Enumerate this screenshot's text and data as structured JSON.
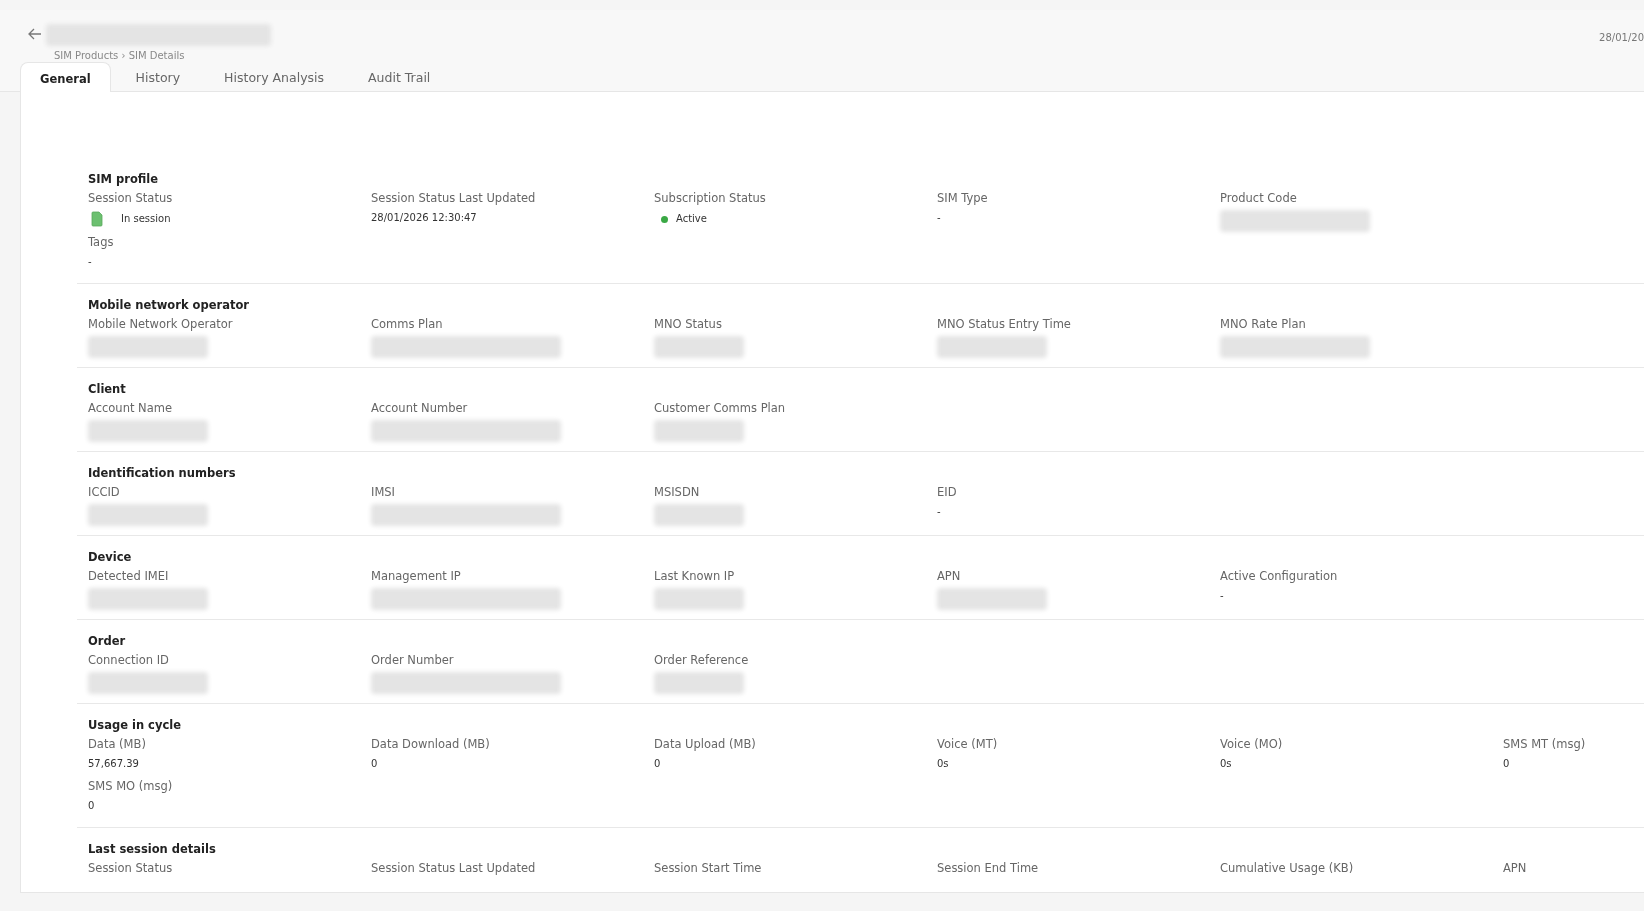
{
  "header": {
    "title_redacted": true,
    "breadcrumb": "SIM Products › SIM Details",
    "date": "28/01/20"
  },
  "tabs": [
    {
      "label": "General",
      "selected": true
    },
    {
      "label": "History",
      "selected": false
    },
    {
      "label": "History Analysis",
      "selected": false
    },
    {
      "label": "Audit Trail",
      "selected": false
    }
  ],
  "sections": [
    {
      "title": "SIM profile",
      "rows": [
        [
          {
            "label": "Session Status",
            "kind": "sim-status",
            "value": "In session"
          },
          {
            "label": "Session Status Last Updated",
            "kind": "text",
            "value": "28/01/2026 12:30:47"
          },
          {
            "label": "Subscription Status",
            "kind": "dot",
            "value": "Active",
            "color": "#3aa845"
          },
          {
            "label": "SIM Type",
            "kind": "text",
            "value": "-"
          },
          {
            "label": "Product Code",
            "kind": "redacted"
          }
        ],
        [
          {
            "label": "Tags",
            "kind": "text",
            "value": "-"
          }
        ]
      ]
    },
    {
      "title": "Mobile network operator",
      "rows": [
        [
          {
            "label": "Mobile Network Operator",
            "kind": "redacted"
          },
          {
            "label": "Comms Plan",
            "kind": "redacted"
          },
          {
            "label": "MNO Status",
            "kind": "redacted"
          },
          {
            "label": "MNO Status Entry Time",
            "kind": "redacted"
          },
          {
            "label": "MNO Rate Plan",
            "kind": "redacted"
          }
        ]
      ]
    },
    {
      "title": "Client",
      "rows": [
        [
          {
            "label": "Account Name",
            "kind": "redacted"
          },
          {
            "label": "Account Number",
            "kind": "redacted"
          },
          {
            "label": "Customer Comms Plan",
            "kind": "redacted"
          }
        ]
      ]
    },
    {
      "title": "Identification numbers",
      "rows": [
        [
          {
            "label": "ICCID",
            "kind": "redacted"
          },
          {
            "label": "IMSI",
            "kind": "redacted"
          },
          {
            "label": "MSISDN",
            "kind": "redacted"
          },
          {
            "label": "EID",
            "kind": "text",
            "value": "-"
          }
        ]
      ]
    },
    {
      "title": "Device",
      "rows": [
        [
          {
            "label": "Detected IMEI",
            "kind": "redacted"
          },
          {
            "label": "Management IP",
            "kind": "redacted"
          },
          {
            "label": "Last Known IP",
            "kind": "redacted"
          },
          {
            "label": "APN",
            "kind": "redacted"
          },
          {
            "label": "Active Configuration",
            "kind": "text",
            "value": "-"
          }
        ]
      ]
    },
    {
      "title": "Order",
      "rows": [
        [
          {
            "label": "Connection ID",
            "kind": "redacted"
          },
          {
            "label": "Order Number",
            "kind": "redacted"
          },
          {
            "label": "Order Reference",
            "kind": "redacted"
          }
        ]
      ]
    },
    {
      "title": "Usage in cycle",
      "rows": [
        [
          {
            "label": "Data (MB)",
            "kind": "text",
            "value": "57,667.39"
          },
          {
            "label": "Data Download (MB)",
            "kind": "text",
            "value": "0"
          },
          {
            "label": "Data Upload (MB)",
            "kind": "text",
            "value": "0"
          },
          {
            "label": "Voice (MT)",
            "kind": "text",
            "value": "0s"
          },
          {
            "label": "Voice (MO)",
            "kind": "text",
            "value": "0s"
          },
          {
            "label": "SMS MT (msg)",
            "kind": "text",
            "value": "0"
          }
        ],
        [
          {
            "label": "SMS MO (msg)",
            "kind": "text",
            "value": "0"
          }
        ]
      ]
    },
    {
      "title": "Last session details",
      "rows": [
        [
          {
            "label": "Session Status",
            "kind": "label-only"
          },
          {
            "label": "Session Status Last Updated",
            "kind": "label-only"
          },
          {
            "label": "Session Start Time",
            "kind": "label-only"
          },
          {
            "label": "Session End Time",
            "kind": "label-only"
          },
          {
            "label": "Cumulative Usage (KB)",
            "kind": "label-only"
          },
          {
            "label": "APN",
            "kind": "label-only"
          }
        ]
      ]
    }
  ]
}
